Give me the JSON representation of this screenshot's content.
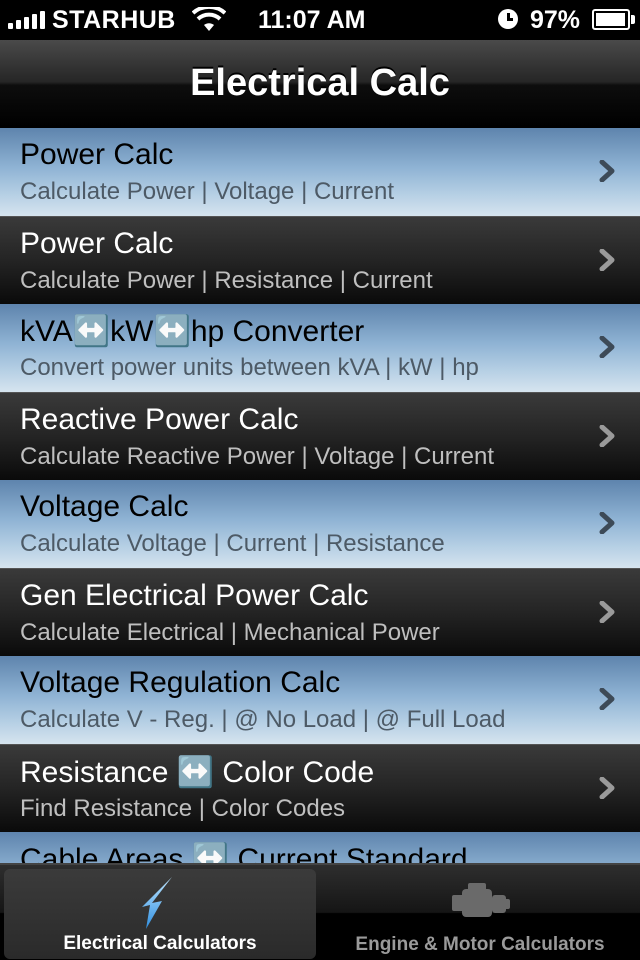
{
  "status_bar": {
    "carrier": "STARHUB",
    "time": "11:07 AM",
    "battery_percent": "97%",
    "battery_level": 0.97
  },
  "nav": {
    "title": "Electrical Calc"
  },
  "rows": [
    {
      "title": "Power Calc",
      "subtitle": "Calculate Power | Voltage | Current",
      "style": "light"
    },
    {
      "title": "Power Calc",
      "subtitle": "Calculate Power | Resistance | Current",
      "style": "dark"
    },
    {
      "title": "kVA↔️kW↔️hp Converter",
      "subtitle": "Convert power units between kVA | kW | hp",
      "style": "light"
    },
    {
      "title": "Reactive Power Calc",
      "subtitle": "Calculate Reactive Power | Voltage | Current",
      "style": "dark"
    },
    {
      "title": "Voltage Calc",
      "subtitle": "Calculate Voltage | Current | Resistance",
      "style": "light"
    },
    {
      "title": "Gen Electrical Power Calc",
      "subtitle": "Calculate Electrical | Mechanical Power",
      "style": "dark"
    },
    {
      "title": "Voltage Regulation Calc",
      "subtitle": "Calculate V - Reg. | @ No Load | @ Full Load",
      "style": "light"
    },
    {
      "title": "Resistance ↔️ Color Code",
      "subtitle": "Find Resistance | Color Codes",
      "style": "dark"
    },
    {
      "title": "Cable Areas ↔️ Current Standard",
      "subtitle": "",
      "style": "light"
    }
  ],
  "tabs": [
    {
      "label": "Electrical Calculators",
      "icon": "lightning-bolt-icon",
      "selected": true
    },
    {
      "label": "Engine & Motor Calculators",
      "icon": "engine-icon",
      "selected": false
    }
  ]
}
